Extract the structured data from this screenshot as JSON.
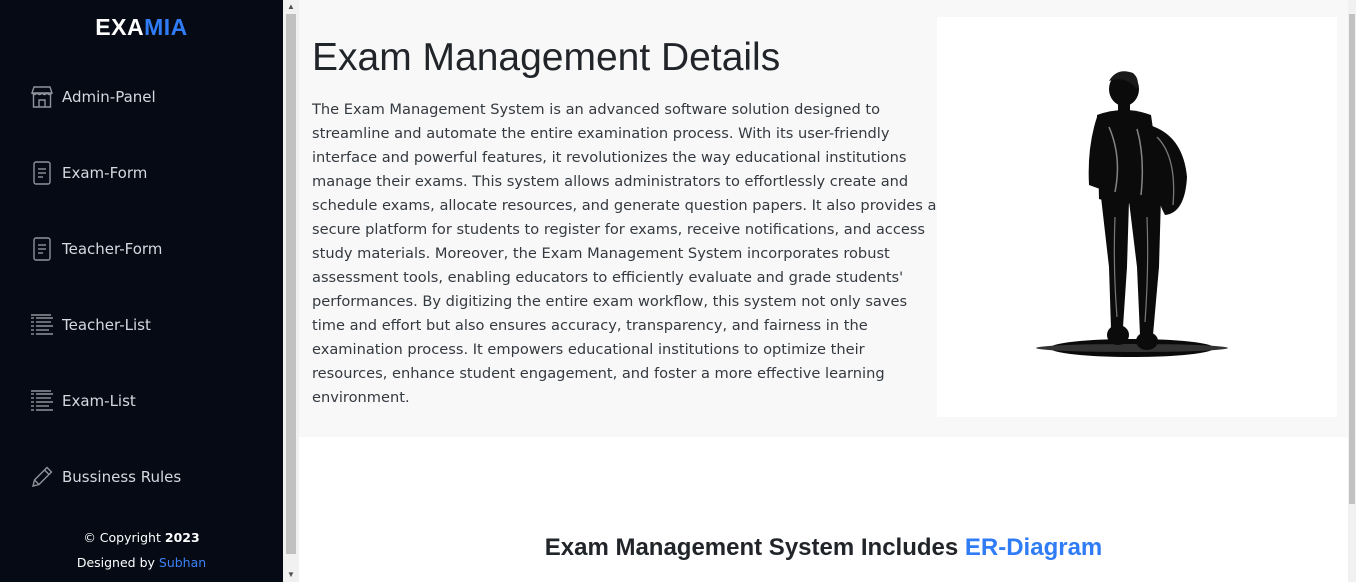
{
  "brand": {
    "part1": "EXA",
    "part2": "MIA",
    "accent_color": "#2f7cf6"
  },
  "sidebar": {
    "items": [
      {
        "label": "Admin-Panel",
        "icon": "store-icon"
      },
      {
        "label": "Exam-Form",
        "icon": "document-icon"
      },
      {
        "label": "Teacher-Form",
        "icon": "document-icon"
      },
      {
        "label": "Teacher-List",
        "icon": "list-icon"
      },
      {
        "label": "Exam-List",
        "icon": "list-icon"
      },
      {
        "label": "Bussiness Rules",
        "icon": "pencil-icon"
      }
    ],
    "footer": {
      "copyright_prefix": "© Copyright",
      "year": "2023",
      "designed_prefix": "Designed by",
      "designer": "Subhan"
    }
  },
  "main": {
    "title": "Exam Management Details",
    "description": "The Exam Management System is an advanced software solution designed to streamline and automate the entire examination process. With its user-friendly interface and powerful features, it revolutionizes the way educational institutions manage their exams. This system allows administrators to effortlessly create and schedule exams, allocate resources, and generate question papers. It also provides a secure platform for students to register for exams, receive notifications, and access study materials. Moreover, the Exam Management System incorporates robust assessment tools, enabling educators to efficiently evaluate and grade students' performances. By digitizing the entire exam workflow, this system not only saves time and effort but also ensures accuracy, transparency, and fairness in the examination process. It empowers educational institutions to optimize their resources, enhance student engagement, and foster a more effective learning environment.",
    "er_heading_prefix": "Exam Management System Includes",
    "er_heading_accent": "ER-Diagram"
  }
}
